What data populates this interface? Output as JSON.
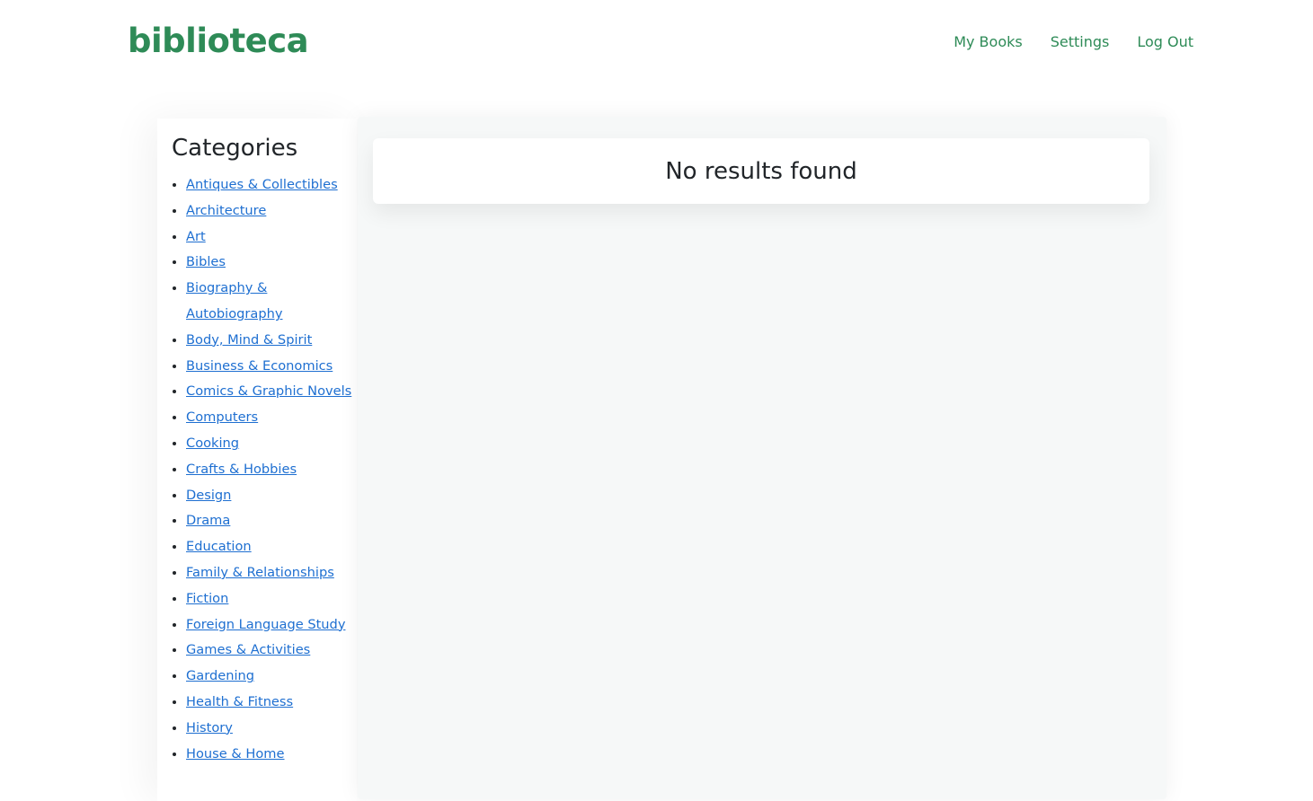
{
  "header": {
    "logo": "biblioteca",
    "nav": [
      "My Books",
      "Settings",
      "Log Out"
    ]
  },
  "sidebar": {
    "title": "Categories",
    "categories": [
      "Antiques & Collectibles",
      "Architecture",
      "Art",
      "Bibles",
      "Biography & Autobiography",
      "Body, Mind & Spirit",
      "Business & Economics",
      "Comics & Graphic Novels",
      "Computers",
      "Cooking",
      "Crafts & Hobbies",
      "Design",
      "Drama",
      "Education",
      "Family & Relationships",
      "Fiction",
      "Foreign Language Study",
      "Games & Activities",
      "Gardening",
      "Health & Fitness",
      "History",
      "House & Home"
    ]
  },
  "main": {
    "message": "No results found"
  },
  "colors": {
    "brand": "#2e8b57",
    "link": "#1e6fd1",
    "panel_bg": "#f6f8f8"
  }
}
